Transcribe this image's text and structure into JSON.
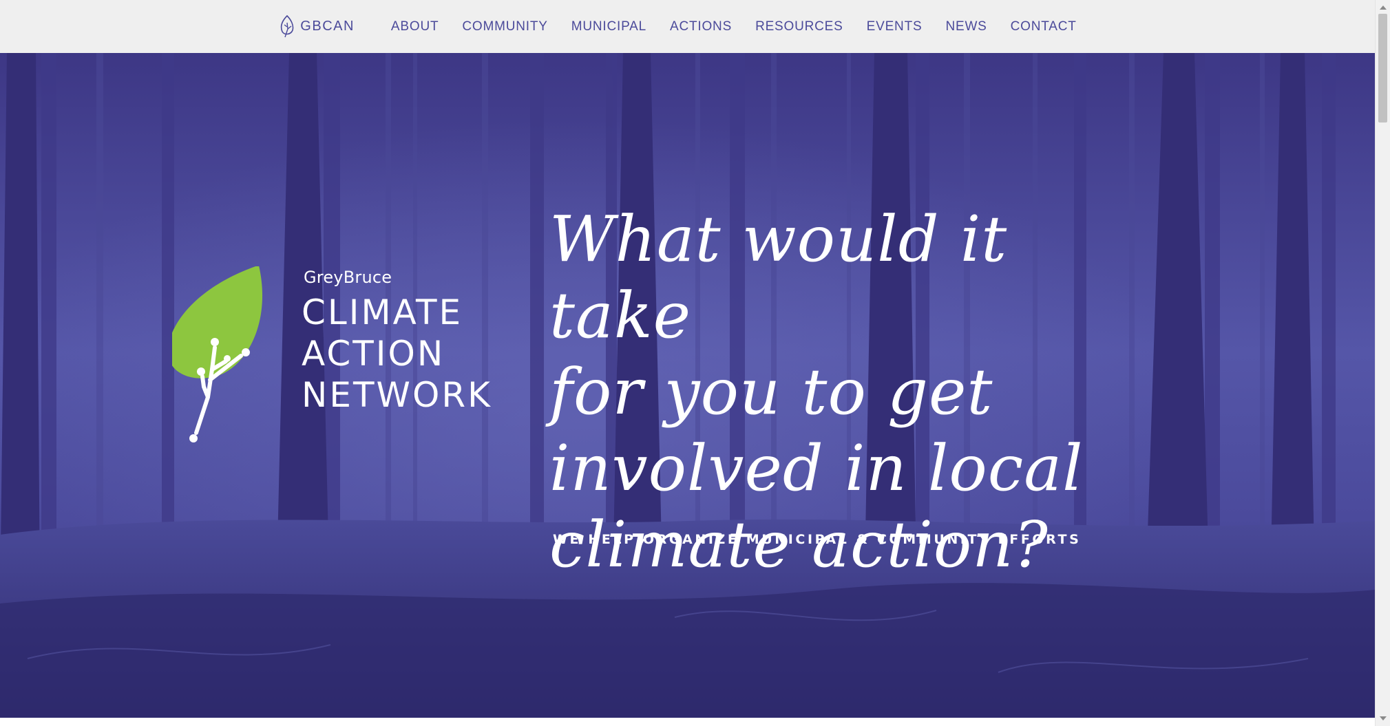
{
  "nav": {
    "brand_label": "GBCAN",
    "brand_icon": "leaf-icon",
    "items": [
      {
        "label": "ABOUT"
      },
      {
        "label": "COMMUNITY"
      },
      {
        "label": "MUNICIPAL"
      },
      {
        "label": "ACTIONS"
      },
      {
        "label": "RESOURCES"
      },
      {
        "label": "EVENTS"
      },
      {
        "label": "NEWS"
      },
      {
        "label": "CONTACT"
      }
    ]
  },
  "hero": {
    "logo": {
      "small_text": "GreyBruce",
      "line1": "CLIMATE",
      "line2": "ACTION",
      "line3": "NETWORK",
      "leaf_color": "#8dc63f"
    },
    "headline_lines": [
      "What would it take",
      "for you to get",
      "involved in local",
      "climate action?"
    ],
    "tagline": "WE HELP ORGANIZE MUNICIPAL & COMMUNITY EFFORTS",
    "overlay_color": "#3b3582"
  },
  "colors": {
    "nav_bg": "#efefef",
    "nav_text": "#4b4a9a",
    "hero_text": "#ffffff"
  }
}
